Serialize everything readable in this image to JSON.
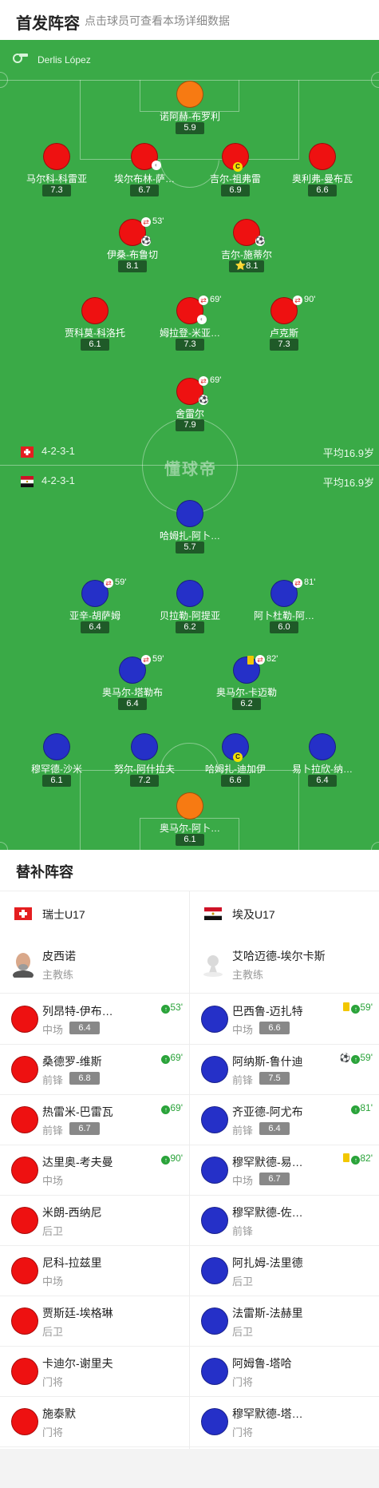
{
  "header": {
    "title": "首发阵容",
    "hint": "点击球员可查看本场详细数据"
  },
  "referee": "Derlis López",
  "watermark": "懂球帝",
  "home": {
    "formation": "4-2-3-1",
    "avg_age": "平均16.9岁",
    "color": "#ee1111",
    "players": [
      {
        "name": "诺阿赫-布罗利",
        "rating": "5.9",
        "kit": "orange"
      },
      {
        "name": "马尔科-科雷亚",
        "rating": "7.3",
        "kit": "red"
      },
      {
        "name": "埃尔布林-萨…",
        "rating": "6.7",
        "kit": "red",
        "band": true
      },
      {
        "name": "吉尔-祖弗雷",
        "rating": "6.9",
        "kit": "red",
        "captain": "C"
      },
      {
        "name": "奥利弗-曼布瓦",
        "rating": "6.6",
        "kit": "red"
      },
      {
        "name": "伊桑-布鲁切",
        "rating": "8.1",
        "kit": "red",
        "sub_out": "53'",
        "goal": true
      },
      {
        "name": "吉尔-施蒂尔",
        "rating": "8.1",
        "kit": "red",
        "goal": true,
        "star": "⭐"
      },
      {
        "name": "贾科莫-科洛托",
        "rating": "6.1",
        "kit": "red"
      },
      {
        "name": "姆拉登-米亚…",
        "rating": "7.3",
        "kit": "red",
        "sub_out": "69'",
        "band": true
      },
      {
        "name": "卢克斯",
        "rating": "7.3",
        "kit": "red",
        "sub_out": "90'"
      },
      {
        "name": "舍雷尔",
        "rating": "7.9",
        "kit": "red",
        "sub_out": "69'",
        "goal": true
      }
    ]
  },
  "away": {
    "formation": "4-2-3-1",
    "avg_age": "平均16.9岁",
    "color": "#2530c8",
    "players": [
      {
        "name": "哈姆扎-阿卜…",
        "rating": "5.7",
        "kit": "blue"
      },
      {
        "name": "亚辛-胡萨姆",
        "rating": "6.4",
        "kit": "blue",
        "sub_out": "59'"
      },
      {
        "name": "贝拉勒-阿提亚",
        "rating": "6.2",
        "kit": "blue"
      },
      {
        "name": "阿卜杜勒-阿…",
        "rating": "6.0",
        "kit": "blue",
        "sub_out": "81'"
      },
      {
        "name": "奥马尔-塔勒布",
        "rating": "6.4",
        "kit": "blue",
        "sub_out": "59'"
      },
      {
        "name": "奥马尔-卡迈勒",
        "rating": "6.2",
        "kit": "blue",
        "sub_out": "82'",
        "yellow": true
      },
      {
        "name": "穆罕德-沙米",
        "rating": "6.1",
        "kit": "blue"
      },
      {
        "name": "努尔-阿什拉夫",
        "rating": "7.2",
        "kit": "blue"
      },
      {
        "name": "哈姆扎-迪加伊",
        "rating": "6.6",
        "kit": "blue",
        "captain": "C"
      },
      {
        "name": "易卜拉欣-纳…",
        "rating": "6.4",
        "kit": "blue"
      },
      {
        "name": "奥马尔-阿卜…",
        "rating": "6.1",
        "kit": "orange"
      }
    ]
  },
  "subs_title": "替补阵容",
  "subs_home": {
    "team": "瑞士U17",
    "coach": {
      "name": "皮西诺",
      "role": "主教练"
    },
    "players": [
      {
        "name": "列昂特-伊布…",
        "pos": "中场",
        "rating": "6.4",
        "in": "53'"
      },
      {
        "name": "桑德罗-维斯",
        "pos": "前锋",
        "rating": "6.8",
        "in": "69'"
      },
      {
        "name": "热雷米-巴雷瓦",
        "pos": "前锋",
        "rating": "6.7",
        "in": "69'"
      },
      {
        "name": "达里奥-考夫曼",
        "pos": "中场",
        "rating": "",
        "in": "90'"
      },
      {
        "name": "米朗-西纳尼",
        "pos": "后卫",
        "rating": "",
        "in": ""
      },
      {
        "name": "尼科-拉兹里",
        "pos": "中场",
        "rating": "",
        "in": ""
      },
      {
        "name": "贾斯廷-埃格琳",
        "pos": "后卫",
        "rating": "",
        "in": ""
      },
      {
        "name": "卡迪尔-谢里夫",
        "pos": "门将",
        "rating": "",
        "in": ""
      },
      {
        "name": "施泰默",
        "pos": "门将",
        "rating": "",
        "in": ""
      }
    ]
  },
  "subs_away": {
    "team": "埃及U17",
    "coach": {
      "name": "艾哈迈德-埃尔卡斯",
      "role": "主教练"
    },
    "players": [
      {
        "name": "巴西鲁-迈扎特",
        "pos": "中场",
        "rating": "6.6",
        "in": "59'",
        "yellow": true
      },
      {
        "name": "阿纳斯-鲁什迪",
        "pos": "前锋",
        "rating": "7.5",
        "in": "59'",
        "goal": true
      },
      {
        "name": "齐亚德-阿尤布",
        "pos": "前锋",
        "rating": "6.4",
        "in": "81'"
      },
      {
        "name": "穆罕默德-易…",
        "pos": "中场",
        "rating": "6.7",
        "in": "82'",
        "yellow": true
      },
      {
        "name": "穆罕默德-佐…",
        "pos": "前锋",
        "rating": "",
        "in": ""
      },
      {
        "name": "阿扎姆-法里德",
        "pos": "后卫",
        "rating": "",
        "in": ""
      },
      {
        "name": "法雷斯-法赫里",
        "pos": "后卫",
        "rating": "",
        "in": ""
      },
      {
        "name": "阿姆鲁-塔哈",
        "pos": "门将",
        "rating": "",
        "in": ""
      },
      {
        "name": "穆罕默德-塔…",
        "pos": "门将",
        "rating": "",
        "in": ""
      }
    ]
  }
}
